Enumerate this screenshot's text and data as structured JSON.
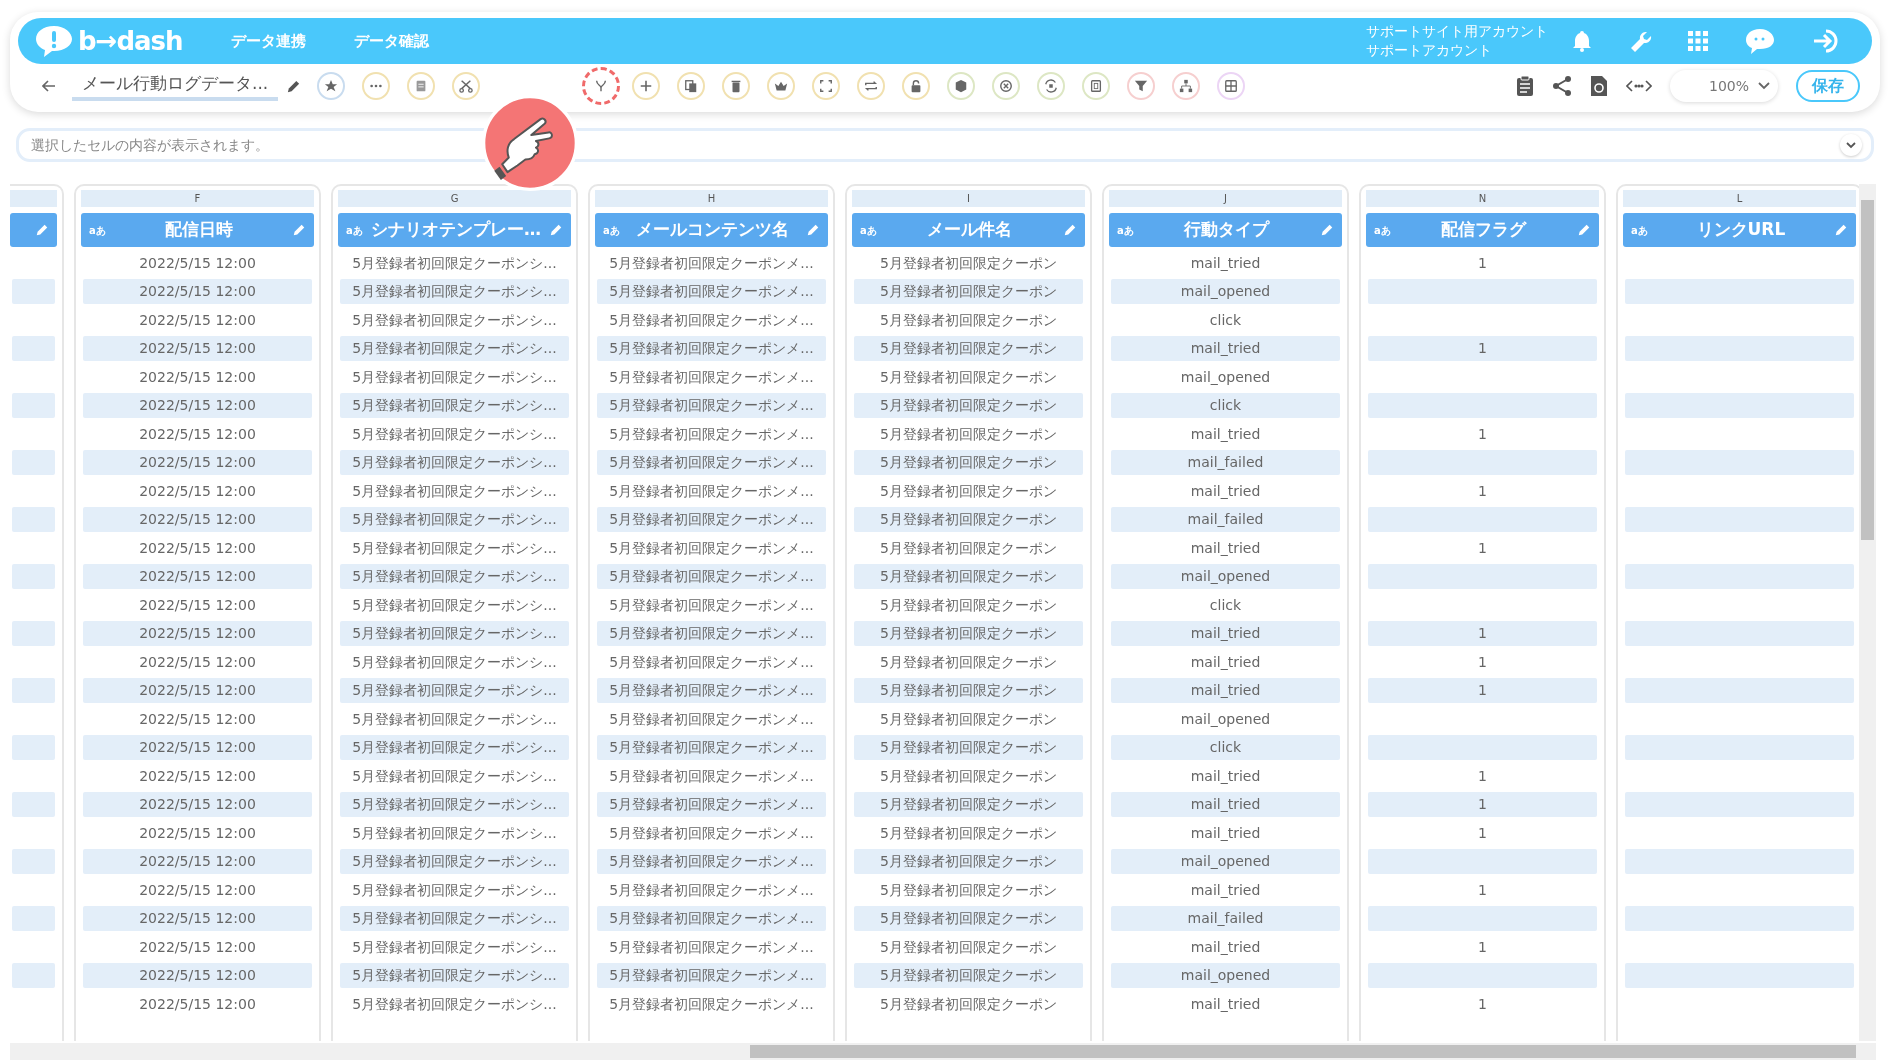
{
  "app": {
    "logo": "b→dash",
    "nav": [
      "データ連携",
      "データ確認"
    ],
    "account": {
      "site": "サポートサイト用アカウント",
      "user": "サポートアカウント"
    }
  },
  "toolbar": {
    "title": "メール行動ログデータ...",
    "zoom": "100%",
    "save": "保存"
  },
  "cell_viewer": {
    "placeholder": "選択したセルの内容が表示されます。"
  },
  "columns": [
    {
      "letter": "F",
      "type": "aあ",
      "name": "配信日時"
    },
    {
      "letter": "G",
      "type": "aあ",
      "name": "シナリオテンプレー…"
    },
    {
      "letter": "H",
      "type": "aあ",
      "name": "メールコンテンツ名"
    },
    {
      "letter": "I",
      "type": "aあ",
      "name": "メール件名"
    },
    {
      "letter": "J",
      "type": "aあ",
      "name": "行動タイプ"
    },
    {
      "letter": "N",
      "type": "aあ",
      "name": "配信フラグ"
    },
    {
      "letter": "L",
      "type": "aあ",
      "name": "リンクURL"
    }
  ],
  "rows": [
    {
      "date": "2022/5/15 12:00",
      "scenario": "5月登録者初回限定クーポンシ...",
      "content": "5月登録者初回限定クーポンメ...",
      "subject": "5月登録者初回限定クーポン",
      "action": "mail_tried",
      "flag": "1"
    },
    {
      "date": "2022/5/15 12:00",
      "scenario": "5月登録者初回限定クーポンシ...",
      "content": "5月登録者初回限定クーポンメ...",
      "subject": "5月登録者初回限定クーポン",
      "action": "mail_opened"
    },
    {
      "date": "2022/5/15 12:00",
      "scenario": "5月登録者初回限定クーポンシ...",
      "content": "5月登録者初回限定クーポンメ...",
      "subject": "5月登録者初回限定クーポン",
      "action": "click"
    },
    {
      "date": "2022/5/15 12:00",
      "scenario": "5月登録者初回限定クーポンシ...",
      "content": "5月登録者初回限定クーポンメ...",
      "subject": "5月登録者初回限定クーポン",
      "action": "mail_tried",
      "flag": "1"
    },
    {
      "date": "2022/5/15 12:00",
      "scenario": "5月登録者初回限定クーポンシ...",
      "content": "5月登録者初回限定クーポンメ...",
      "subject": "5月登録者初回限定クーポン",
      "action": "mail_opened"
    },
    {
      "date": "2022/5/15 12:00",
      "scenario": "5月登録者初回限定クーポンシ...",
      "content": "5月登録者初回限定クーポンメ...",
      "subject": "5月登録者初回限定クーポン",
      "action": "click"
    },
    {
      "date": "2022/5/15 12:00",
      "scenario": "5月登録者初回限定クーポンシ...",
      "content": "5月登録者初回限定クーポンメ...",
      "subject": "5月登録者初回限定クーポン",
      "action": "mail_tried",
      "flag": "1"
    },
    {
      "date": "2022/5/15 12:00",
      "scenario": "5月登録者初回限定クーポンシ...",
      "content": "5月登録者初回限定クーポンメ...",
      "subject": "5月登録者初回限定クーポン",
      "action": "mail_failed"
    },
    {
      "date": "2022/5/15 12:00",
      "scenario": "5月登録者初回限定クーポンシ...",
      "content": "5月登録者初回限定クーポンメ...",
      "subject": "5月登録者初回限定クーポン",
      "action": "mail_tried",
      "flag": "1"
    },
    {
      "date": "2022/5/15 12:00",
      "scenario": "5月登録者初回限定クーポンシ...",
      "content": "5月登録者初回限定クーポンメ...",
      "subject": "5月登録者初回限定クーポン",
      "action": "mail_failed"
    },
    {
      "date": "2022/5/15 12:00",
      "scenario": "5月登録者初回限定クーポンシ...",
      "content": "5月登録者初回限定クーポンメ...",
      "subject": "5月登録者初回限定クーポン",
      "action": "mail_tried",
      "flag": "1"
    },
    {
      "date": "2022/5/15 12:00",
      "scenario": "5月登録者初回限定クーポンシ...",
      "content": "5月登録者初回限定クーポンメ...",
      "subject": "5月登録者初回限定クーポン",
      "action": "mail_opened"
    },
    {
      "date": "2022/5/15 12:00",
      "scenario": "5月登録者初回限定クーポンシ...",
      "content": "5月登録者初回限定クーポンメ...",
      "subject": "5月登録者初回限定クーポン",
      "action": "click"
    },
    {
      "date": "2022/5/15 12:00",
      "scenario": "5月登録者初回限定クーポンシ...",
      "content": "5月登録者初回限定クーポンメ...",
      "subject": "5月登録者初回限定クーポン",
      "action": "mail_tried",
      "flag": "1"
    },
    {
      "date": "2022/5/15 12:00",
      "scenario": "5月登録者初回限定クーポンシ...",
      "content": "5月登録者初回限定クーポンメ...",
      "subject": "5月登録者初回限定クーポン",
      "action": "mail_tried",
      "flag": "1"
    },
    {
      "date": "2022/5/15 12:00",
      "scenario": "5月登録者初回限定クーポンシ...",
      "content": "5月登録者初回限定クーポンメ...",
      "subject": "5月登録者初回限定クーポン",
      "action": "mail_tried",
      "flag": "1"
    },
    {
      "date": "2022/5/15 12:00",
      "scenario": "5月登録者初回限定クーポンシ...",
      "content": "5月登録者初回限定クーポンメ...",
      "subject": "5月登録者初回限定クーポン",
      "action": "mail_opened"
    },
    {
      "date": "2022/5/15 12:00",
      "scenario": "5月登録者初回限定クーポンシ...",
      "content": "5月登録者初回限定クーポンメ...",
      "subject": "5月登録者初回限定クーポン",
      "action": "click"
    },
    {
      "date": "2022/5/15 12:00",
      "scenario": "5月登録者初回限定クーポンシ...",
      "content": "5月登録者初回限定クーポンメ...",
      "subject": "5月登録者初回限定クーポン",
      "action": "mail_tried",
      "flag": "1"
    },
    {
      "date": "2022/5/15 12:00",
      "scenario": "5月登録者初回限定クーポンシ...",
      "content": "5月登録者初回限定クーポンメ...",
      "subject": "5月登録者初回限定クーポン",
      "action": "mail_tried",
      "flag": "1"
    },
    {
      "date": "2022/5/15 12:00",
      "scenario": "5月登録者初回限定クーポンシ...",
      "content": "5月登録者初回限定クーポンメ...",
      "subject": "5月登録者初回限定クーポン",
      "action": "mail_tried",
      "flag": "1"
    },
    {
      "date": "2022/5/15 12:00",
      "scenario": "5月登録者初回限定クーポンシ...",
      "content": "5月登録者初回限定クーポンメ...",
      "subject": "5月登録者初回限定クーポン",
      "action": "mail_opened"
    },
    {
      "date": "2022/5/15 12:00",
      "scenario": "5月登録者初回限定クーポンシ...",
      "content": "5月登録者初回限定クーポンメ...",
      "subject": "5月登録者初回限定クーポン",
      "action": "mail_tried",
      "flag": "1"
    },
    {
      "date": "2022/5/15 12:00",
      "scenario": "5月登録者初回限定クーポンシ...",
      "content": "5月登録者初回限定クーポンメ...",
      "subject": "5月登録者初回限定クーポン",
      "action": "mail_failed"
    },
    {
      "date": "2022/5/15 12:00",
      "scenario": "5月登録者初回限定クーポンシ...",
      "content": "5月登録者初回限定クーポンメ...",
      "subject": "5月登録者初回限定クーポン",
      "action": "mail_tried",
      "flag": "1"
    },
    {
      "date": "2022/5/15 12:00",
      "scenario": "5月登録者初回限定クーポンシ...",
      "content": "5月登録者初回限定クーポンメ...",
      "subject": "5月登録者初回限定クーポン",
      "action": "mail_opened"
    },
    {
      "date": "2022/5/15 12:00",
      "scenario": "5月登録者初回限定クーポンシ...",
      "content": "5月登録者初回限定クーポンメ...",
      "subject": "5月登録者初回限定クーポン",
      "action": "mail_tried",
      "flag": "1"
    }
  ]
}
